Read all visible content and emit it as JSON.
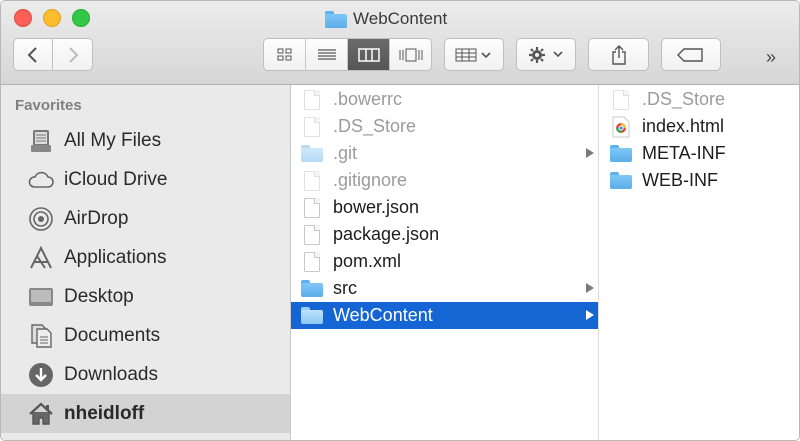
{
  "window": {
    "title": "WebContent",
    "title_icon": "folder-icon"
  },
  "toolbar": {
    "back_icon": "chevron-left-icon",
    "forward_icon": "chevron-right-icon",
    "view_modes": [
      "icon-view",
      "list-view",
      "column-view",
      "cover-flow-view"
    ],
    "active_view": "column-view",
    "arrange_icon": "arrange-grid-icon",
    "action_icon": "gear-icon",
    "share_icon": "share-icon",
    "tags_icon": "tag-icon",
    "overflow_label": "»"
  },
  "sidebar": {
    "header": "Favorites",
    "items": [
      {
        "label": "All My Files",
        "icon": "all-files-icon"
      },
      {
        "label": "iCloud Drive",
        "icon": "cloud-icon"
      },
      {
        "label": "AirDrop",
        "icon": "airdrop-icon"
      },
      {
        "label": "Applications",
        "icon": "applications-icon"
      },
      {
        "label": "Desktop",
        "icon": "desktop-icon"
      },
      {
        "label": "Documents",
        "icon": "documents-icon"
      },
      {
        "label": "Downloads",
        "icon": "downloads-icon"
      },
      {
        "label": "nheidloff",
        "icon": "home-icon",
        "selected": true
      }
    ]
  },
  "column1": {
    "items": [
      {
        "name": ".bowerrc",
        "type": "file",
        "hidden": true
      },
      {
        "name": ".DS_Store",
        "type": "file",
        "hidden": true
      },
      {
        "name": ".git",
        "type": "folder",
        "hidden": true
      },
      {
        "name": ".gitignore",
        "type": "file",
        "hidden": true
      },
      {
        "name": "bower.json",
        "type": "file"
      },
      {
        "name": "package.json",
        "type": "file"
      },
      {
        "name": "pom.xml",
        "type": "file"
      },
      {
        "name": "src",
        "type": "folder"
      },
      {
        "name": "WebContent",
        "type": "folder",
        "selected": true
      }
    ]
  },
  "column2": {
    "items": [
      {
        "name": ".DS_Store",
        "type": "file",
        "hidden": true
      },
      {
        "name": "index.html",
        "type": "html"
      },
      {
        "name": "META-INF",
        "type": "folder"
      },
      {
        "name": "WEB-INF",
        "type": "folder"
      }
    ]
  },
  "colors": {
    "selection": "#1565d4",
    "folder": "#5aaeea",
    "close": "#fc5f57",
    "minimize": "#fdbc2e",
    "zoom": "#33c748"
  }
}
